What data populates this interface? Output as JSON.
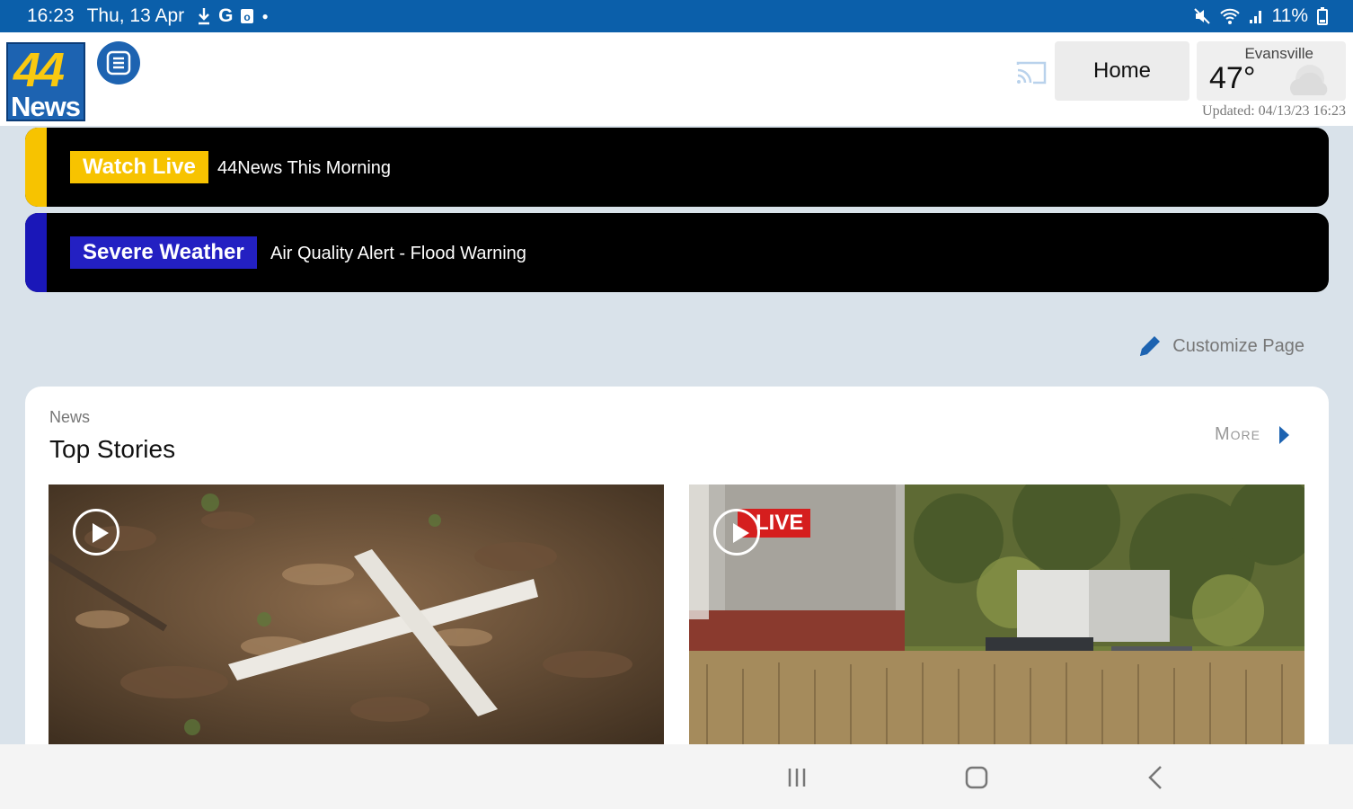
{
  "status_bar": {
    "time": "16:23",
    "date": "Thu, 13 Apr",
    "battery": "11%",
    "notif_icons": [
      "download-icon",
      "google-icon",
      "outlook-icon"
    ],
    "sys_icons": [
      "mute-icon",
      "wifi-icon",
      "signal-icon",
      "battery-icon"
    ]
  },
  "header": {
    "logo_number": "44",
    "logo_word": "News",
    "home_label": "Home",
    "weather": {
      "city": "Evansville",
      "temperature": "47°",
      "updated": "Updated: 04/13/23 16:23"
    }
  },
  "alerts": [
    {
      "tag": "Watch Live",
      "message": "44News This Morning",
      "accent": "#f7c300",
      "tag_bg": "#f7c300",
      "tag_color": "#ffffff"
    },
    {
      "tag": "Severe Weather",
      "message": "Air Quality Alert -  Flood Warning",
      "accent": "#1a17b8",
      "tag_bg": "#2320c2",
      "tag_color": "#ffffff"
    }
  ],
  "customize_label": "Customize Page",
  "section": {
    "category": "News",
    "title": "Top Stories",
    "more_label": "More",
    "stories": [
      {
        "type": "video",
        "badge": ""
      },
      {
        "type": "video",
        "badge": "LIVE"
      }
    ]
  },
  "colors": {
    "brand_blue": "#1d63b1",
    "status_bar": "#0b5faa",
    "page_bg": "#d9e2ea"
  }
}
